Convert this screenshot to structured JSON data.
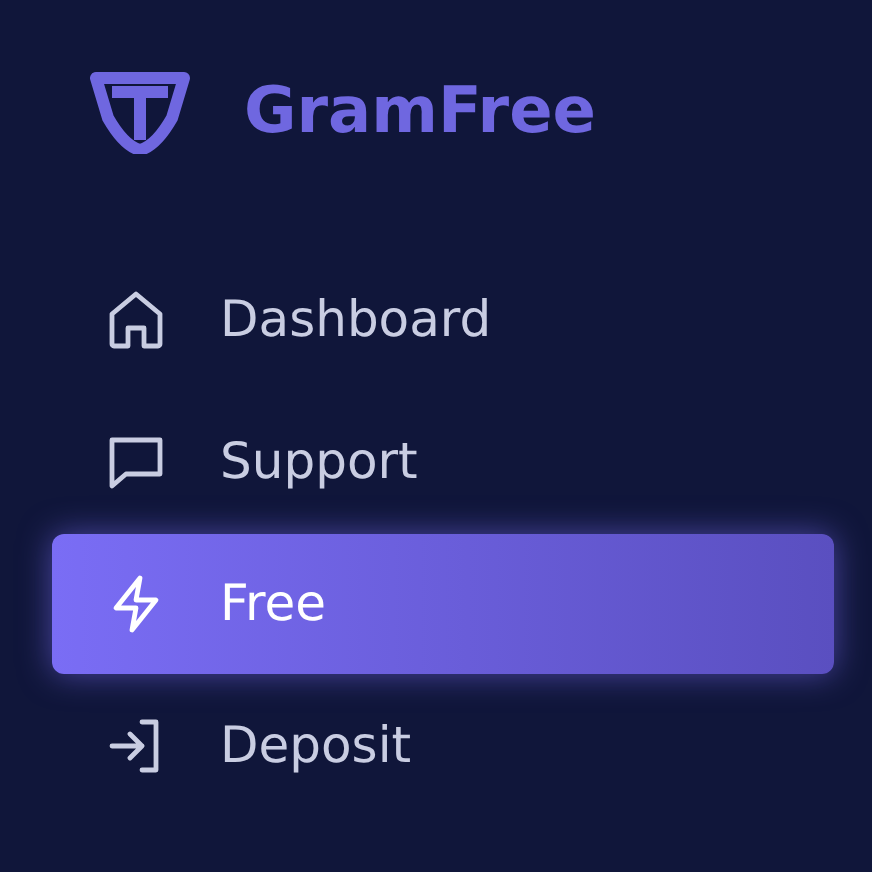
{
  "brand": {
    "name": "GramFree"
  },
  "menu": [
    {
      "label": "Dashboard",
      "kind": "home",
      "selected": false
    },
    {
      "label": "Support",
      "kind": "chat",
      "selected": false
    },
    {
      "label": "Free",
      "kind": "bolt",
      "selected": true
    },
    {
      "label": "Deposit",
      "kind": "login",
      "selected": false
    }
  ]
}
